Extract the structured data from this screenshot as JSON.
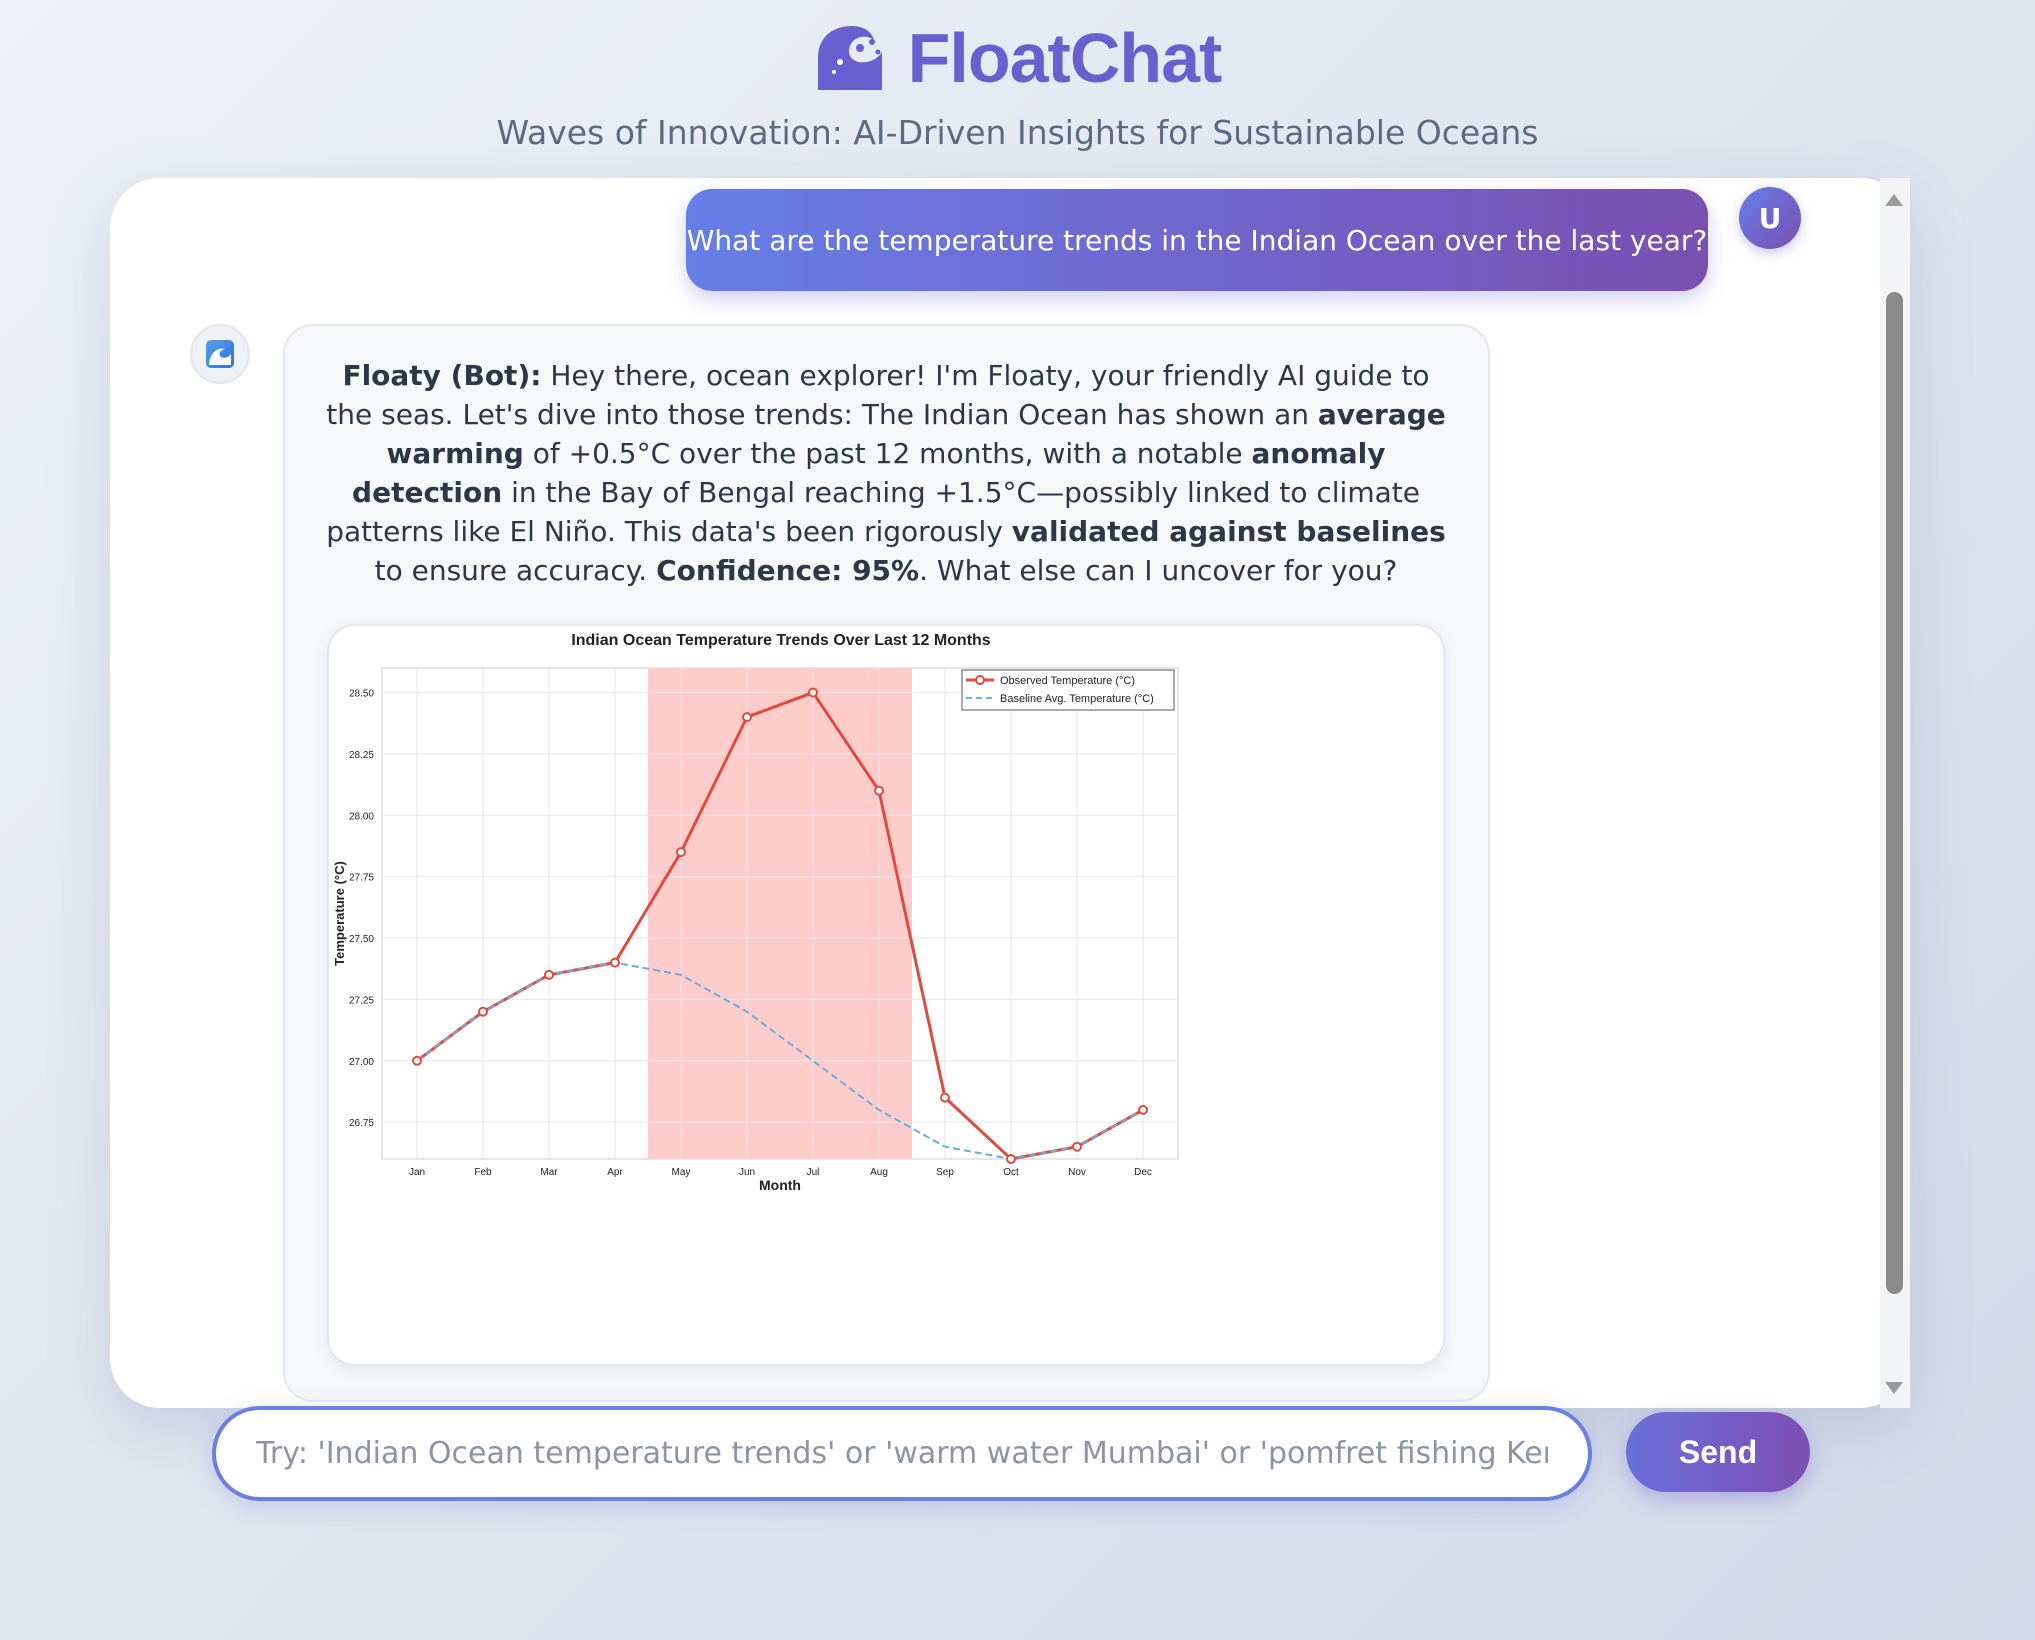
{
  "header": {
    "title": "FloatChat",
    "tagline": "Waves of Innovation: AI-Driven Insights for Sustainable Oceans"
  },
  "chat": {
    "user": {
      "avatar_letter": "U",
      "message": "What are the temperature trends in the Indian Ocean over the last year?"
    },
    "bot": {
      "sender": "Floaty (Bot):",
      "segments": [
        {
          "text": " Hey there, ocean explorer! I'm Floaty, your friendly AI guide to the seas. Let's dive into those trends: The Indian Ocean has shown an ",
          "bold": false
        },
        {
          "text": "average warming",
          "bold": true
        },
        {
          "text": " of +0.5°C over the past 12 months, with a notable ",
          "bold": false
        },
        {
          "text": "anomaly detection",
          "bold": true
        },
        {
          "text": " in the Bay of Bengal reaching +1.5°C—possibly linked to climate patterns like El Niño. This data's been rigorously ",
          "bold": false
        },
        {
          "text": "validated against baselines",
          "bold": true
        },
        {
          "text": " to ensure accuracy. ",
          "bold": false
        },
        {
          "text": "Confidence: 95%",
          "bold": true
        },
        {
          "text": ". What else can I uncover for you?",
          "bold": false
        }
      ]
    }
  },
  "input": {
    "placeholder": "Try: 'Indian Ocean temperature trends' or 'warm water Mumbai' or 'pomfret fishing Kerala'",
    "value": ""
  },
  "send_label": "Send",
  "colors": {
    "accent": "#6b5fcf",
    "observed": "#e04a3f",
    "baseline": "#6aaee0",
    "anomaly_shade": "#ffc9c9"
  },
  "chart_data": {
    "type": "line",
    "title": "Indian Ocean Temperature Trends Over Last 12 Months",
    "xlabel": "Month",
    "ylabel": "Temperature (°C)",
    "categories": [
      "Jan",
      "Feb",
      "Mar",
      "Apr",
      "May",
      "Jun",
      "Jul",
      "Aug",
      "Sep",
      "Oct",
      "Nov",
      "Dec"
    ],
    "series": [
      {
        "name": "Observed Temperature (°C)",
        "style": "solid-markers",
        "values": [
          27.0,
          27.2,
          27.35,
          27.4,
          27.85,
          28.4,
          28.5,
          28.1,
          26.85,
          26.6,
          26.65,
          26.8
        ]
      },
      {
        "name": "Baseline Avg. Temperature (°C)",
        "style": "dashed",
        "values": [
          27.0,
          27.2,
          27.35,
          27.4,
          27.35,
          27.2,
          27.0,
          26.8,
          26.65,
          26.6,
          26.65,
          26.8
        ]
      }
    ],
    "anomaly_band": {
      "from": 3.5,
      "to": 7.5
    },
    "ylim": [
      26.6,
      28.6
    ],
    "yticks": [
      "26.75",
      "27.00",
      "27.25",
      "27.50",
      "27.75",
      "28.00",
      "28.25",
      "28.50"
    ],
    "grid": true,
    "legend": "top-right"
  }
}
